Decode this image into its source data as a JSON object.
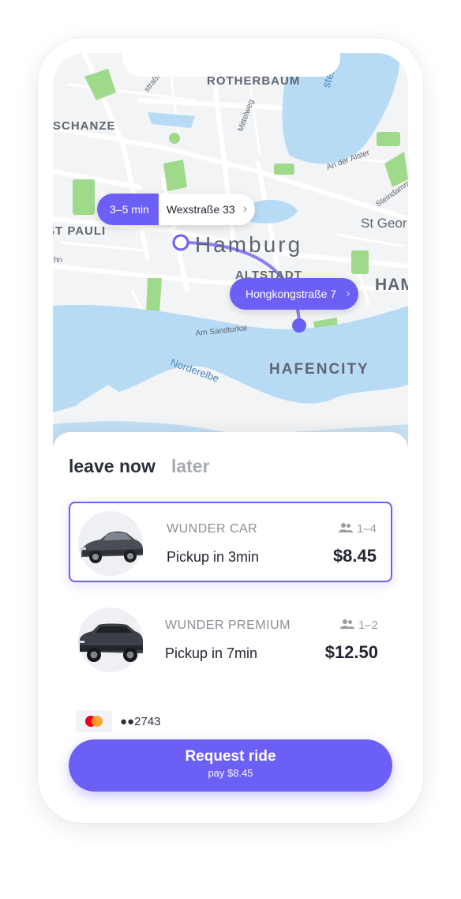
{
  "map": {
    "city_label": "Hamburg",
    "district_labels": [
      "ROTHERBAUM",
      "SCHANZE",
      "ST PAULI",
      "ALTSTADT",
      "HAFENCITY",
      "HAM",
      "St Geor"
    ],
    "street_labels": [
      "Mittelweg",
      "An der Alster",
      "Steindamm",
      "Am Sandtorkai",
      "Norderelbe",
      "straße",
      "ster",
      "hn"
    ],
    "origin_pill": {
      "eta": "3–5 min",
      "address": "Wexstraße 33",
      "chevron": "›"
    },
    "destination_pill": {
      "address": "Hongkongstraße 7",
      "chevron": "›"
    }
  },
  "tabs": {
    "active": "leave now",
    "inactive": "later"
  },
  "rides": [
    {
      "name": "WUNDER CAR",
      "capacity": "1–4",
      "pickup": "Pickup in 3min",
      "price": "$8.45",
      "selected": true,
      "icon": "car-sedan-icon"
    },
    {
      "name": "WUNDER PREMIUM",
      "capacity": "1–2",
      "pickup": "Pickup in 7min",
      "price": "$12.50",
      "selected": false,
      "icon": "car-suv-icon"
    }
  ],
  "payment": {
    "card_brand_icon": "mastercard-icon",
    "card_masked": "●●2743"
  },
  "request": {
    "title": "Request ride",
    "subtitle": "pay $8.45"
  },
  "colors": {
    "accent": "#6c5ff5",
    "water": "#b7dbf4",
    "park": "#9fd98a",
    "land": "#f3f4f6"
  }
}
